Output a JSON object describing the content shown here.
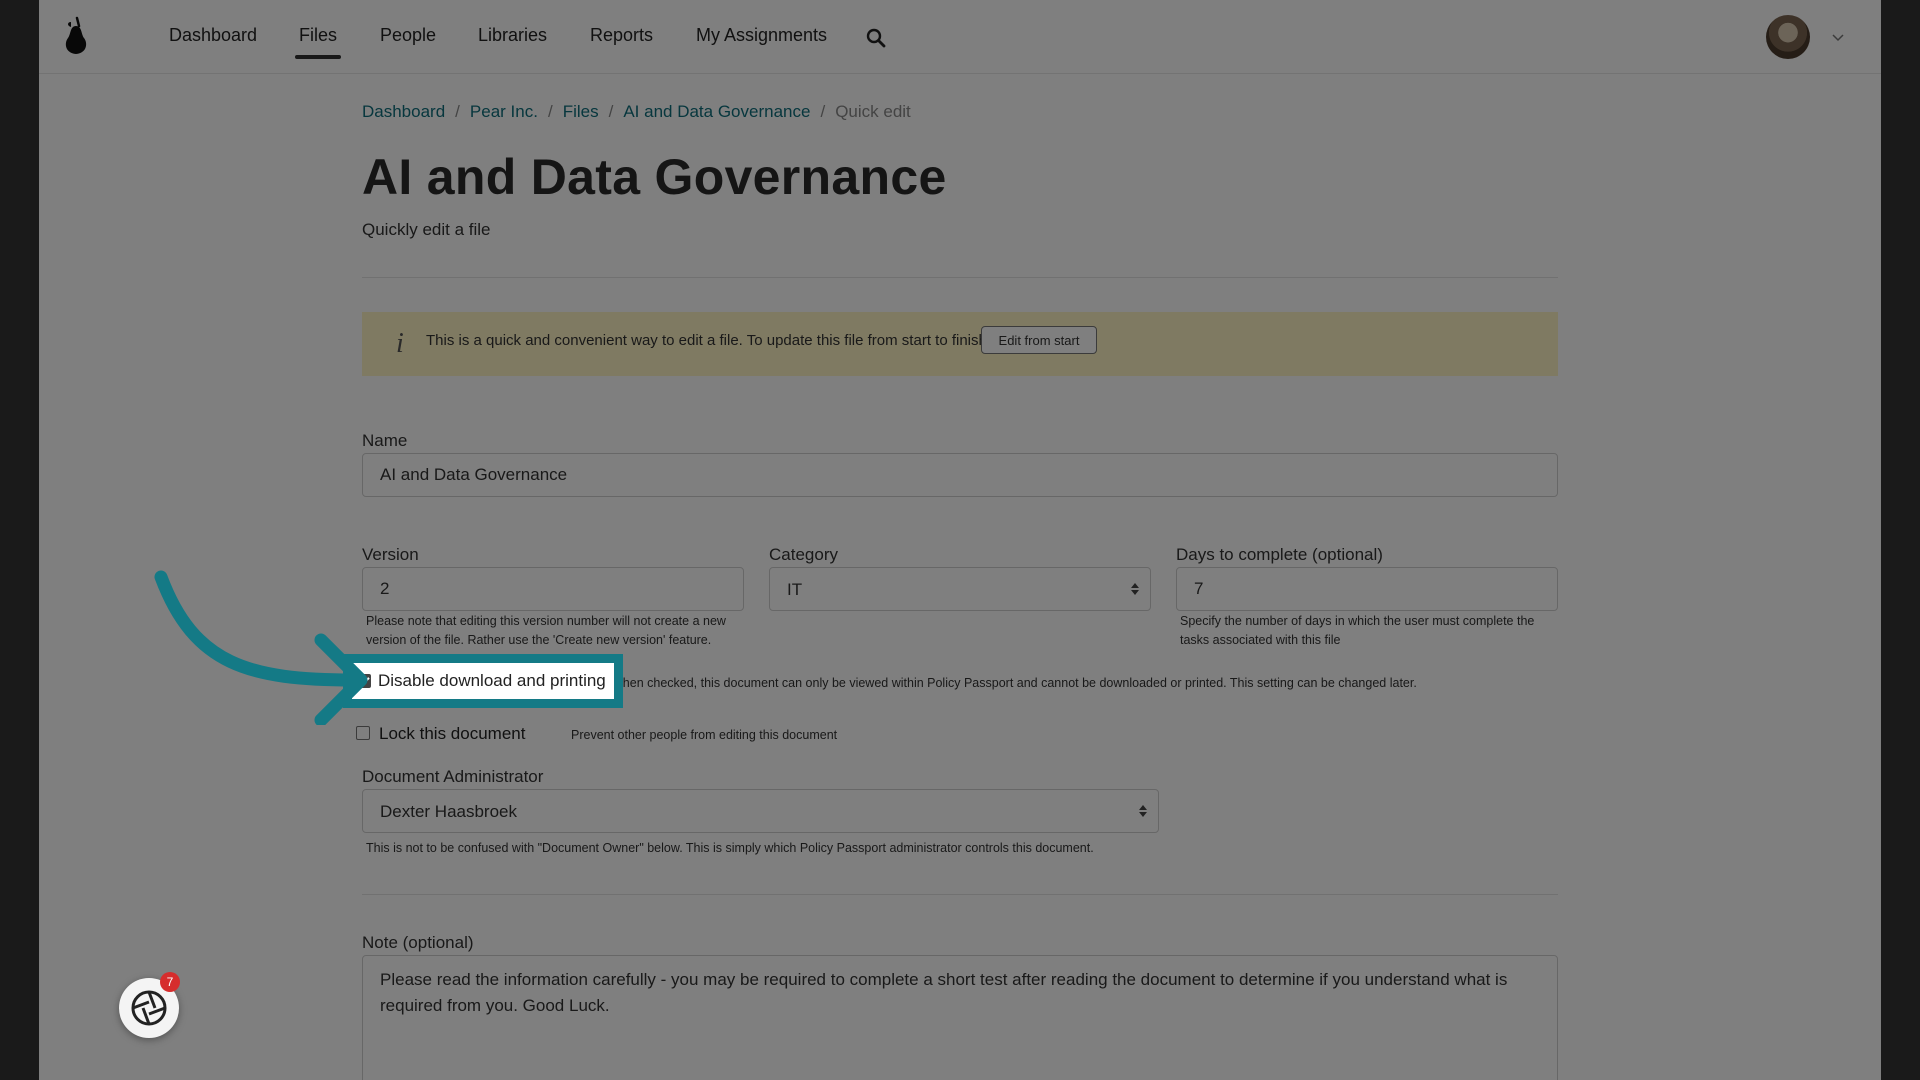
{
  "nav": {
    "items": [
      {
        "label": "Dashboard"
      },
      {
        "label": "Files"
      },
      {
        "label": "People"
      },
      {
        "label": "Libraries"
      },
      {
        "label": "Reports"
      },
      {
        "label": "My Assignments"
      }
    ],
    "active": "Files"
  },
  "breadcrumb": {
    "items": [
      "Dashboard",
      "Pear Inc.",
      "Files",
      "AI and Data Governance"
    ],
    "separator": "/",
    "current": "Quick edit"
  },
  "page": {
    "title": "AI and Data Governance",
    "subtitle": "Quickly edit a file"
  },
  "info": {
    "text": "This is a quick and convenient way to edit a file. To update this file from start to finish",
    "button": "Edit from start"
  },
  "form": {
    "name": {
      "label": "Name",
      "value": "AI and Data Governance"
    },
    "version": {
      "label": "Version",
      "value": "2",
      "help_line1": "Please note that editing this version number will not create a new",
      "help_line2": "version of the file. Rather use the 'Create new version' feature."
    },
    "category": {
      "label": "Category",
      "value": "IT"
    },
    "days": {
      "label": "Days to complete (optional)",
      "value": "7",
      "help_line1": "Specify the number of days in which the user must complete the",
      "help_line2": "tasks associated with this file"
    },
    "disable_download": {
      "label": "Disable download and printing",
      "checked": true,
      "help": "When checked, this document can only be viewed within Policy Passport and cannot be downloaded or printed. This setting can be changed later."
    },
    "lock": {
      "label": "Lock this document",
      "checked": false,
      "help": "Prevent other people from editing this document"
    },
    "admin": {
      "label": "Document Administrator",
      "value": "Dexter Haasbroek",
      "help": "This is not to be confused with \"Document Owner\" below. This is simply which Policy Passport administrator controls this document."
    },
    "note": {
      "label": "Note (optional)",
      "value": "Please read the information carefully - you may be required to complete a short test after reading the document to determine if you understand what is required from you. Good Luck."
    }
  },
  "chat": {
    "badge": "7"
  },
  "colors": {
    "accent": "#0f6e7c",
    "highlight": "#147a86",
    "info_bg": "#fff4c4",
    "badge": "#d62d2d"
  }
}
